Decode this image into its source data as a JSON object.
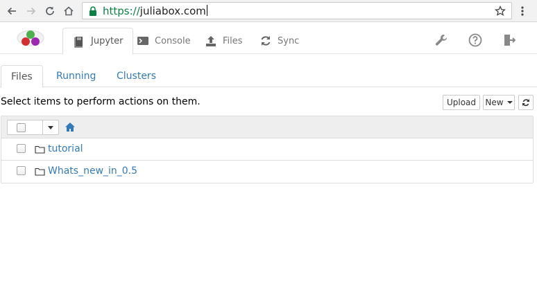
{
  "browser": {
    "url_scheme": "https://",
    "url_host": "juliabox.com"
  },
  "header": {
    "tabs": [
      {
        "label": "Jupyter",
        "icon": "notebook-icon",
        "active": true
      },
      {
        "label": "Console",
        "icon": "terminal-icon"
      },
      {
        "label": "Files",
        "icon": "upload-icon"
      },
      {
        "label": "Sync",
        "icon": "sync-icon"
      }
    ],
    "right_icons": [
      "wrench-icon",
      "help-icon",
      "logout-icon"
    ]
  },
  "tabs": [
    {
      "label": "Files",
      "active": true
    },
    {
      "label": "Running"
    },
    {
      "label": "Clusters"
    }
  ],
  "instructions": "Select items to perform actions on them.",
  "toolbar": {
    "upload_label": "Upload",
    "new_label": "New"
  },
  "files": [
    {
      "name": "tutorial",
      "type": "folder"
    },
    {
      "name": "Whats_new_in_0.5",
      "type": "folder"
    }
  ],
  "colors": {
    "link": "#337ab7",
    "secure": "#0b8043"
  }
}
